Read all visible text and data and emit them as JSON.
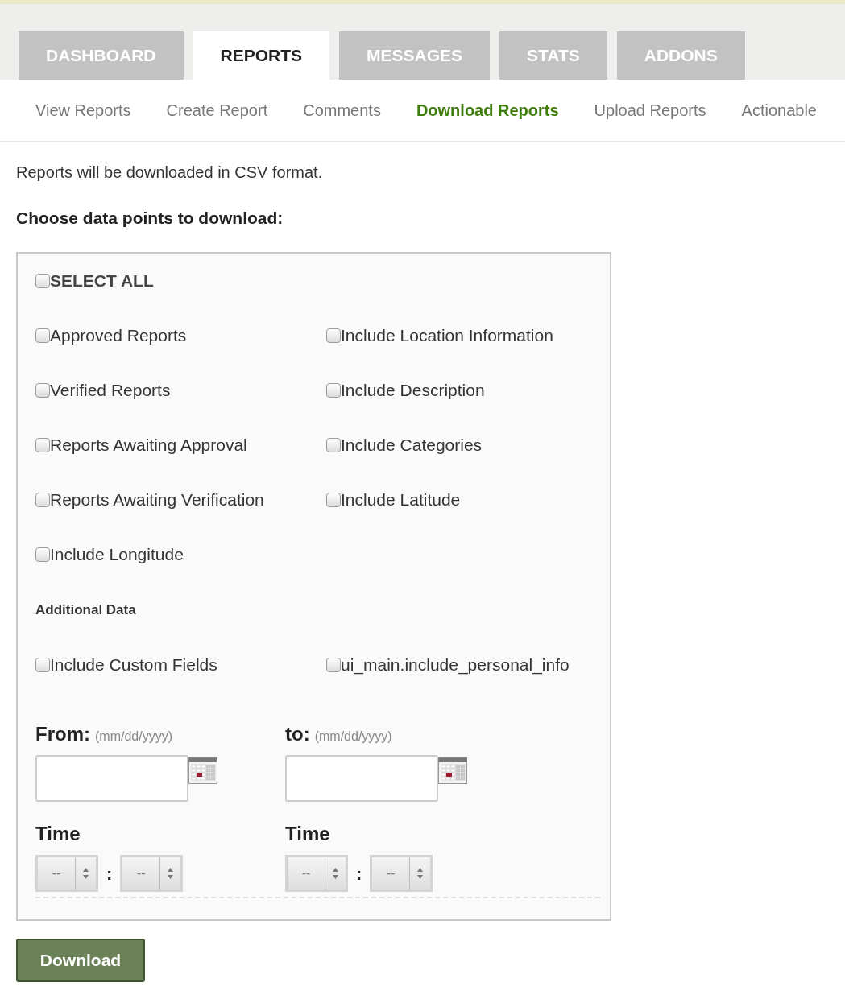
{
  "tabs": [
    {
      "label": "DASHBOARD",
      "selected": false
    },
    {
      "label": "REPORTS",
      "selected": true
    },
    {
      "label": "MESSAGES",
      "selected": false
    },
    {
      "label": "STATS",
      "selected": false
    },
    {
      "label": "ADDONS",
      "selected": false
    }
  ],
  "subnav": [
    {
      "label": "View Reports",
      "selected": false
    },
    {
      "label": "Create Report",
      "selected": false
    },
    {
      "label": "Comments",
      "selected": false
    },
    {
      "label": "Download Reports",
      "selected": true
    },
    {
      "label": "Upload Reports",
      "selected": false
    },
    {
      "label": "Actionable",
      "selected": false
    }
  ],
  "intro": "Reports will be downloaded in CSV format.",
  "heading": "Choose data points to download:",
  "select_all": {
    "label": "SELECT ALL",
    "checked": false
  },
  "options": [
    {
      "label": "Approved Reports",
      "checked": false
    },
    {
      "label": "Include Location Information",
      "checked": false
    },
    {
      "label": "Verified Reports",
      "checked": false
    },
    {
      "label": "Include Description",
      "checked": false
    },
    {
      "label": "Reports Awaiting Approval",
      "checked": false
    },
    {
      "label": "Include Categories",
      "checked": false
    },
    {
      "label": "Reports Awaiting Verification",
      "checked": false
    },
    {
      "label": "Include Latitude",
      "checked": false
    },
    {
      "label": "Include Longitude",
      "checked": false
    }
  ],
  "additional_heading": "Additional Data",
  "additional_options": [
    {
      "label": "Include Custom Fields",
      "checked": false
    },
    {
      "label": "ui_main.include_personal_info",
      "checked": false
    }
  ],
  "ranges": [
    {
      "date_label": "From:",
      "date_hint": "(mm/dd/yyyy)",
      "time_label": "Time",
      "hour": "--",
      "separator": ":",
      "minute": "--"
    },
    {
      "date_label": "to:",
      "date_hint": "(mm/dd/yyyy)",
      "time_label": "Time",
      "hour": "--",
      "separator": ":",
      "minute": "--"
    }
  ],
  "download_button": "Download"
}
